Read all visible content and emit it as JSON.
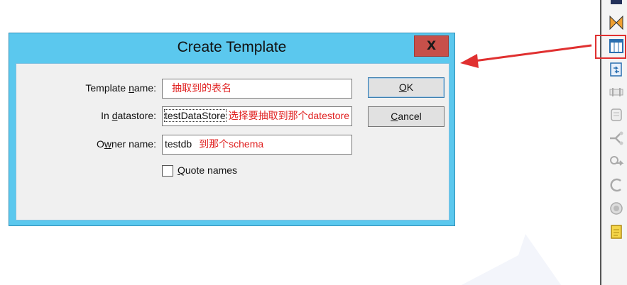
{
  "dialog": {
    "title": "Create Template",
    "close_label": "X",
    "fields": {
      "template_name": {
        "label_pre": "Template ",
        "label_mnemonic": "n",
        "label_post": "ame:",
        "value": "",
        "annotation": "抽取到的表名"
      },
      "in_datastore": {
        "label_pre": "In ",
        "label_mnemonic": "d",
        "label_post": "atastore:",
        "value": "testDataStore",
        "annotation": "选择要抽取到那个datestore"
      },
      "owner_name": {
        "label_pre": "O",
        "label_mnemonic": "w",
        "label_post": "ner name:",
        "value": "testdb",
        "annotation": "到那个schema"
      }
    },
    "checkbox": {
      "label_mnemonic": "Q",
      "label_post": "uote names",
      "checked": false
    },
    "buttons": {
      "ok": {
        "mnemonic": "O",
        "post": "K"
      },
      "cancel": {
        "mnemonic": "C",
        "post": "ancel"
      }
    }
  },
  "annotation_color": "#e02020",
  "toolbar": {
    "icons": [
      "bookmark-icon",
      "join-icon",
      "template-table-icon",
      "import-icon",
      "pipe-icon",
      "scroll-icon",
      "split-icon",
      "key-icon",
      "loop-icon",
      "circle-icon",
      "note-icon"
    ]
  }
}
